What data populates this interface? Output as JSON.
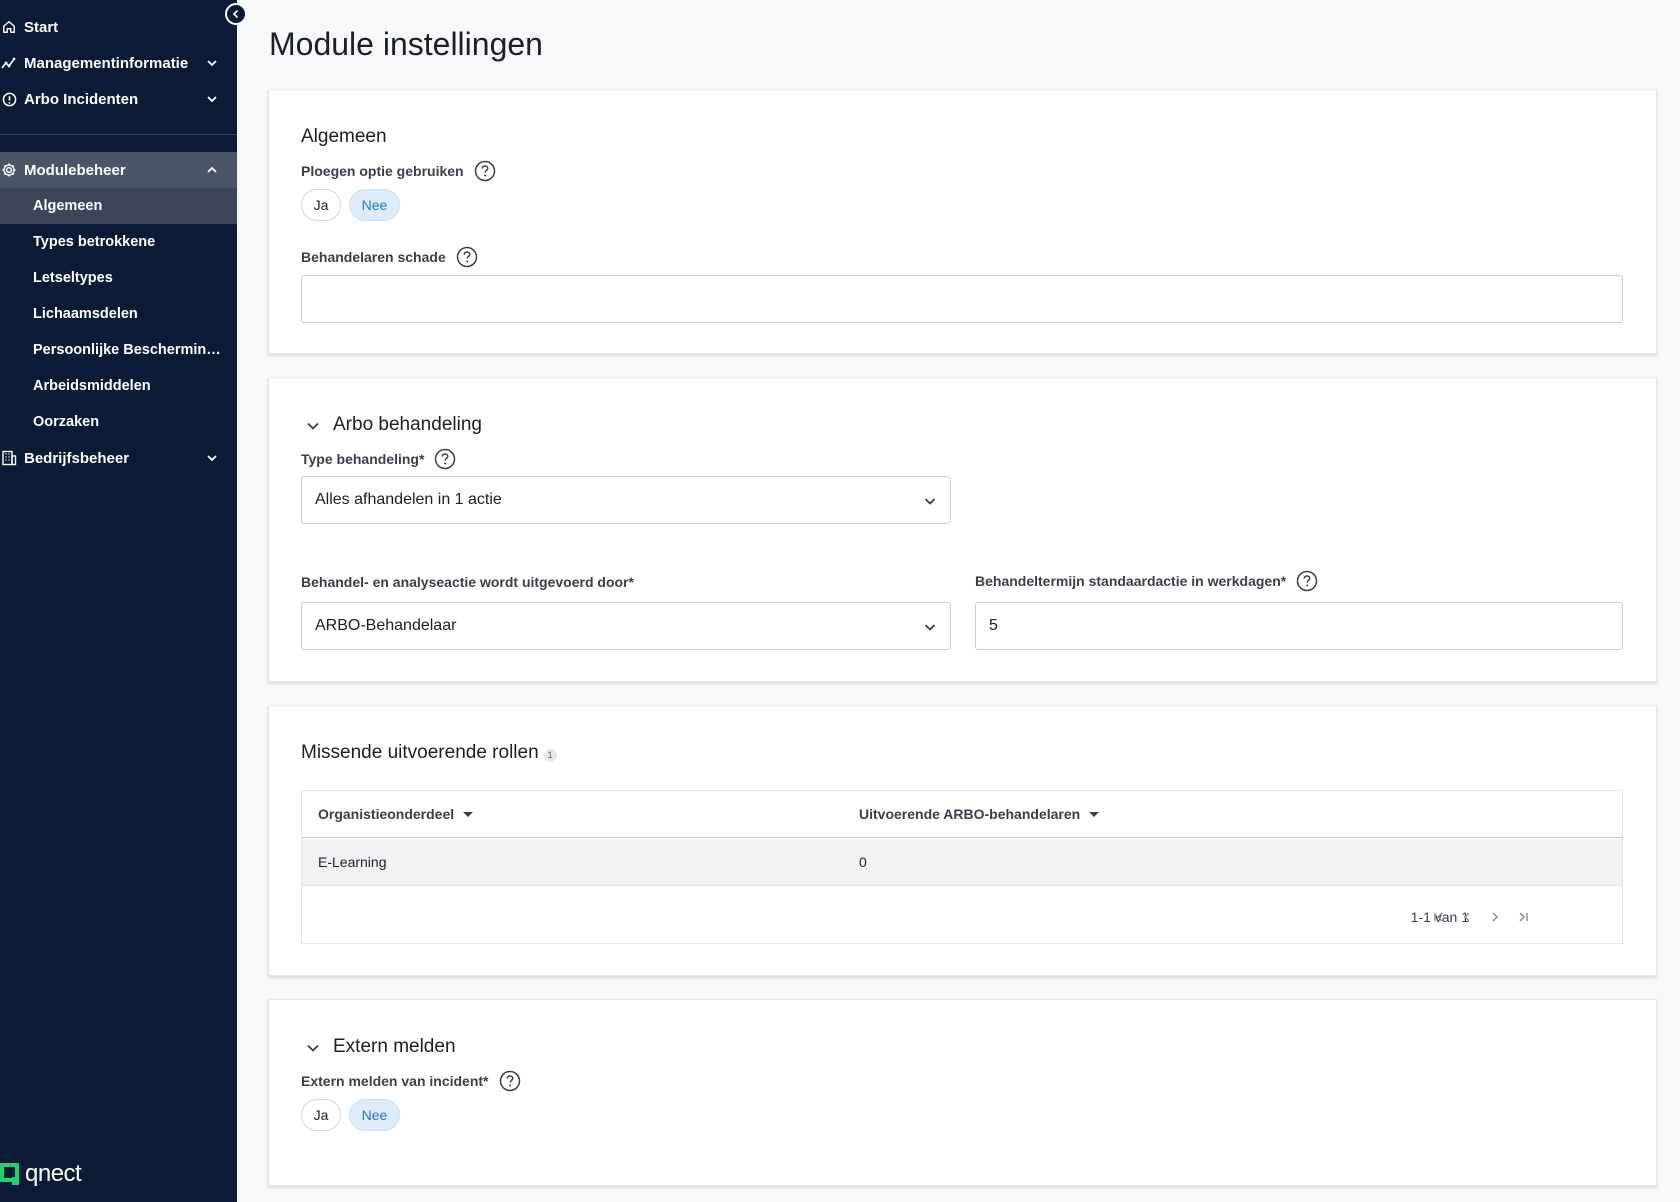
{
  "sidebar": {
    "items": [
      {
        "label": "Start",
        "icon": "home-icon"
      },
      {
        "label": "Managementinformatie",
        "icon": "chart-icon"
      },
      {
        "label": "Arbo Incidenten",
        "icon": "alert-icon"
      },
      {
        "label": "Modulebeheer",
        "icon": "gear-icon"
      },
      {
        "label": "Bedrijfsbeheer",
        "icon": "building-icon"
      }
    ],
    "sub_items": [
      {
        "label": "Algemeen"
      },
      {
        "label": "Types betrokkene"
      },
      {
        "label": "Letseltypes"
      },
      {
        "label": "Lichaamsdelen"
      },
      {
        "label": "Persoonlijke Beschermingsmiddelen"
      },
      {
        "label": "Arbeidsmiddelen"
      },
      {
        "label": "Oorzaken"
      }
    ],
    "logo_text": "qnect"
  },
  "page": {
    "title": "Module instellingen"
  },
  "algemeen": {
    "title": "Algemeen",
    "ploegen_label": "Ploegen optie gebruiken",
    "yes": "Ja",
    "no": "Nee",
    "selected": "Nee",
    "behandelaren_label": "Behandelaren schade",
    "behandelaren_value": ""
  },
  "arbo": {
    "title": "Arbo behandeling",
    "type_label": "Type behandeling*",
    "type_value": "Alles afhandelen in 1 actie",
    "uitgevoerd_label": "Behandel- en analyseactie wordt uitgevoerd door*",
    "uitgevoerd_value": "ARBO-Behandelaar",
    "termijn_label": "Behandeltermijn standaardactie in werkdagen*",
    "termijn_value": "5"
  },
  "missende": {
    "title": "Missende uitvoerende rollen",
    "count": "1",
    "columns": [
      "Organistieonderdeel",
      "Uitvoerende ARBO-behandelaren"
    ],
    "rows": [
      [
        "E-Learning",
        "0"
      ]
    ],
    "pagination": "1-1 van 1"
  },
  "extern": {
    "title": "Extern melden",
    "label": "Extern melden van incident*",
    "yes": "Ja",
    "no": "Nee",
    "selected": "Nee"
  },
  "colors": {
    "sidebar_bg": "#0b1b36",
    "accent": "#2477c2",
    "logo_green": "#1fd36b"
  }
}
